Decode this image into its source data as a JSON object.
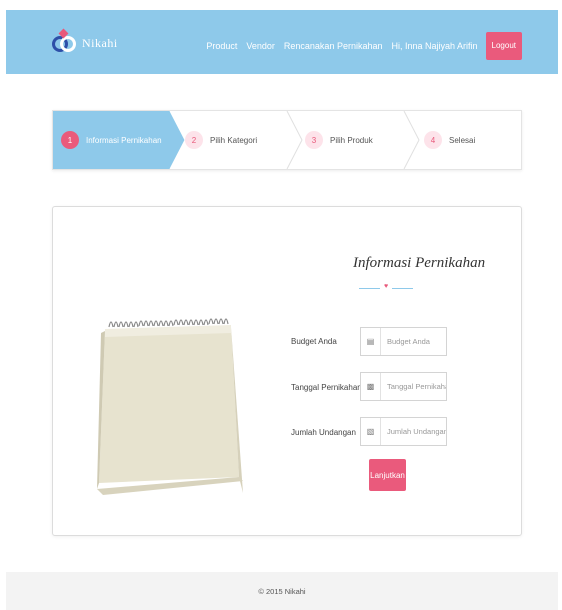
{
  "navbar": {
    "brand": "Nikahi",
    "links": [
      "Product",
      "Vendor",
      "Rencanakan Pernikahan",
      "Hi, Inna Najiyah Arifin"
    ],
    "logout_label": "Logout",
    "bg_color": "#8ec9ea",
    "accent_color": "#ea5a7c"
  },
  "steps": [
    {
      "number": "1",
      "label": "Informasi Pernikahan",
      "active": true
    },
    {
      "number": "2",
      "label": "Pilih Kategori",
      "active": false
    },
    {
      "number": "3",
      "label": "Pilih Produk",
      "active": false
    },
    {
      "number": "4",
      "label": "Selesai",
      "active": false
    }
  ],
  "form": {
    "title": "Informasi Pernikahan",
    "fields": [
      {
        "label": "Budget Anda",
        "placeholder": "Budget Anda",
        "icon": "money-icon"
      },
      {
        "label": "Tanggal Pernikahan",
        "placeholder": "Tanggal Pernikahan",
        "icon": "calendar-icon"
      },
      {
        "label": "Jumlah Undangan",
        "placeholder": "Jumlah Undangan",
        "icon": "invitation-count-icon"
      }
    ],
    "submit_label": "Lanjutkan"
  },
  "footer": {
    "text": "© 2015 Nikahi"
  }
}
